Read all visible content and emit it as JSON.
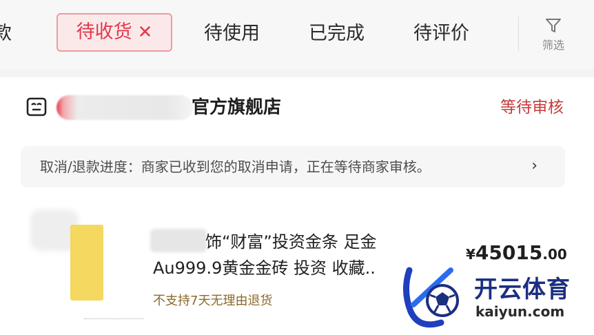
{
  "tabs": [
    {
      "label": "款",
      "cut": true
    },
    {
      "label": "待收货",
      "active": true,
      "close_glyph": "✕"
    },
    {
      "label": "待使用"
    },
    {
      "label": "已完成"
    },
    {
      "label": "待评价"
    }
  ],
  "filter": {
    "label": "筛选",
    "icon": "funnel-icon"
  },
  "order": {
    "shop_name_visible": "官方旗舰店",
    "shop_chevron": "›",
    "status": "等待审核",
    "progress_text": "取消/退款进度：商家已收到您的取消申请，正在等待商家审核。",
    "progress_chevron": "›",
    "product": {
      "title_line1": "饰“财富”投资金条 足金",
      "title_line2": "Au999.9黄金金砖 投资 收藏..",
      "tag": "不支持7天无理由退货",
      "price_symbol": "¥",
      "price_int": "45015",
      "price_dec": ".00"
    }
  },
  "watermark": {
    "name": "开云体育",
    "url": "kaiyun.com"
  },
  "colors": {
    "accent": "#e2384a",
    "status": "#c63a3a",
    "gold": "#f4d85f",
    "brand": "#1b2f80"
  }
}
